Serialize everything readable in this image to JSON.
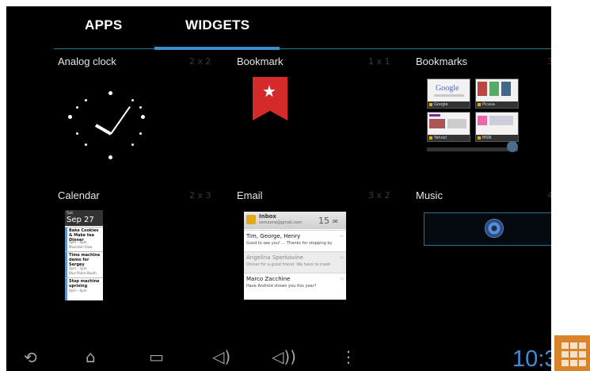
{
  "tabs": [
    {
      "label": "APPS",
      "selected": false
    },
    {
      "label": "WIDGETS",
      "selected": true
    }
  ],
  "widgets": [
    {
      "title": "Analog clock",
      "size": "2 x 2"
    },
    {
      "title": "Bookmark",
      "size": "1 x 1"
    },
    {
      "title": "Bookmarks",
      "size": "3"
    },
    {
      "title": "Calendar",
      "size": "2 x 3"
    },
    {
      "title": "Email",
      "size": "3 x 2"
    },
    {
      "title": "Music",
      "size": "4"
    }
  ],
  "bookmarks_thumbs": [
    {
      "label": "Google"
    },
    {
      "label": "Picasa"
    },
    {
      "label": "Yahoo!"
    },
    {
      "label": "MSN"
    }
  ],
  "calendar": {
    "day": "Sat",
    "date": "Sep 27",
    "events": [
      {
        "title": "Bake Cookies & Make tea Dinner",
        "time": "3pm – 4pm",
        "place": "Mountain View"
      },
      {
        "title": "Time machine demo for Sergey",
        "time": "4pm – 5pm",
        "place": "Blue Police Booth"
      },
      {
        "title": "Stop machine uprising",
        "time": "4pm – 6pm",
        "place": ""
      }
    ]
  },
  "email": {
    "inbox": "Inbox",
    "address": "someone@gmail.com",
    "count": "15",
    "messages": [
      {
        "from": "Tim, George, Henry",
        "subject": "Good to see you! … Thanks for stopping by",
        "read": false
      },
      {
        "from": "Angelina Sperkovine",
        "subject": "Dinner for a good friend. We have to meet",
        "read": true
      },
      {
        "from": "Marco Zacchine",
        "subject": "Have Android shown you this year?",
        "read": false
      }
    ]
  },
  "nav": {
    "back_icon": "back-icon",
    "home_icon": "home-icon",
    "recents_icon": "recents-icon",
    "vol_down_icon": "volume-down-icon",
    "vol_up_icon": "volume-up-icon",
    "menu_icon": "menu-icon",
    "time": "10:3"
  },
  "colors": {
    "accent": "#3a8fc8",
    "bookmark_red": "#d42a2a",
    "apps_orange": "#d7842a"
  }
}
